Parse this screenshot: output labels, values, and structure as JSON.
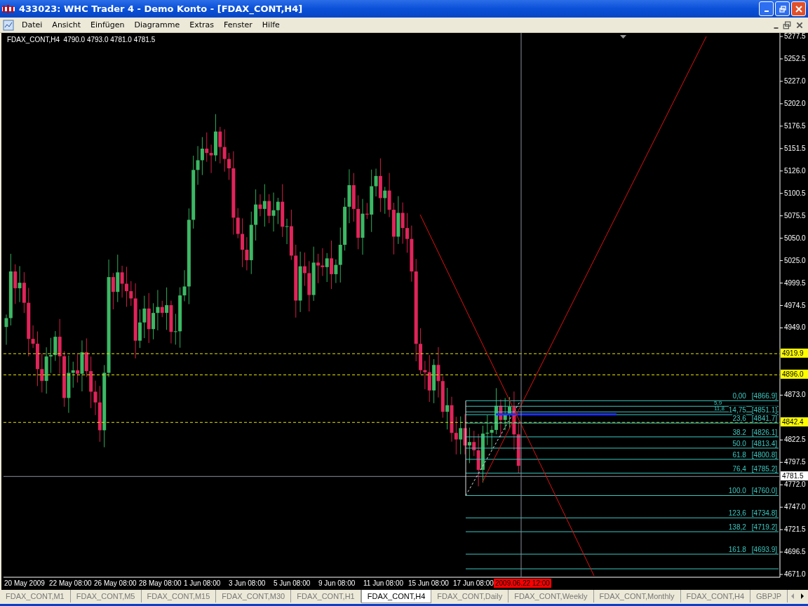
{
  "window": {
    "title": "433023: WHC Trader 4 - Demo Konto - [FDAX_CONT,H4]"
  },
  "menu": [
    "Datei",
    "Ansicht",
    "Einfügen",
    "Diagramme",
    "Extras",
    "Fenster",
    "Hilfe"
  ],
  "chart": {
    "info": "FDAX_CONT,H4  4790.0 4793.0 4781.0 4781.5",
    "price_axis": [
      "5277.5",
      "5252.5",
      "5227.0",
      "5202.0",
      "5176.5",
      "5151.5",
      "5126.0",
      "5100.5",
      "5075.5",
      "5050.0",
      "5025.0",
      "4999.5",
      "4974.5",
      "4949.0",
      "4873.0",
      "4822.5",
      "4797.5",
      "4772.0",
      "4747.0",
      "4721.5",
      "4696.5",
      "4671.0"
    ],
    "price_labels": [
      {
        "kind": "line",
        "text": "4919.9"
      },
      {
        "kind": "line",
        "text": "4896.0"
      },
      {
        "kind": "line",
        "text": "4842.4"
      },
      {
        "kind": "bid",
        "text": "4781.5"
      }
    ],
    "fib_levels": [
      {
        "ratio": "0,00",
        "price": "[4866.9]"
      },
      {
        "ratio": "5,9"
      },
      {
        "ratio": "11,8"
      },
      {
        "ratio": "14,75",
        "price": "[4851.1]"
      },
      {
        "ratio": "23,6",
        "price": "[4841.7]"
      },
      {
        "ratio": "38.2",
        "price": "[4826.1]"
      },
      {
        "ratio": "50.0",
        "price": "[4813.4]"
      },
      {
        "ratio": "61.8",
        "price": "[4800.8]"
      },
      {
        "ratio": "76,4",
        "price": "[4785.2]"
      },
      {
        "ratio": "100.0",
        "price": "[4760.0]"
      },
      {
        "ratio": "123,6",
        "price": "[4734.8]"
      },
      {
        "ratio": "138,2",
        "price": "[4719.2]"
      },
      {
        "ratio": "161.8",
        "price": "[4693.9]"
      }
    ],
    "time_axis": [
      "20 May 2009",
      "22 May 08:00",
      "26 May 08:00",
      "28 May 08:00",
      "1 Jun 08:00",
      "3 Jun 08:00",
      "5 Jun 08:00",
      "9 Jun 08:00",
      "11 Jun 08:00",
      "15 Jun 08:00",
      "17 Jun 08:00"
    ],
    "cursor_time": "2009.06.22 12:00"
  },
  "tabs": [
    {
      "label": "FDAX_CONT,M1",
      "selected": false
    },
    {
      "label": "FDAX_CONT,M5",
      "selected": false
    },
    {
      "label": "FDAX_CONT,M15",
      "selected": false
    },
    {
      "label": "FDAX_CONT,M30",
      "selected": false
    },
    {
      "label": "FDAX_CONT,H1",
      "selected": false
    },
    {
      "label": "FDAX_CONT,H4",
      "selected": true
    },
    {
      "label": "FDAX_CONT,Daily",
      "selected": false
    },
    {
      "label": "FDAX_CONT,Weekly",
      "selected": false
    },
    {
      "label": "FDAX_CONT,Monthly",
      "selected": false
    },
    {
      "label": "FDAX_CONT,H4",
      "selected": false
    },
    {
      "label": "GBPJP",
      "selected": false
    }
  ]
}
